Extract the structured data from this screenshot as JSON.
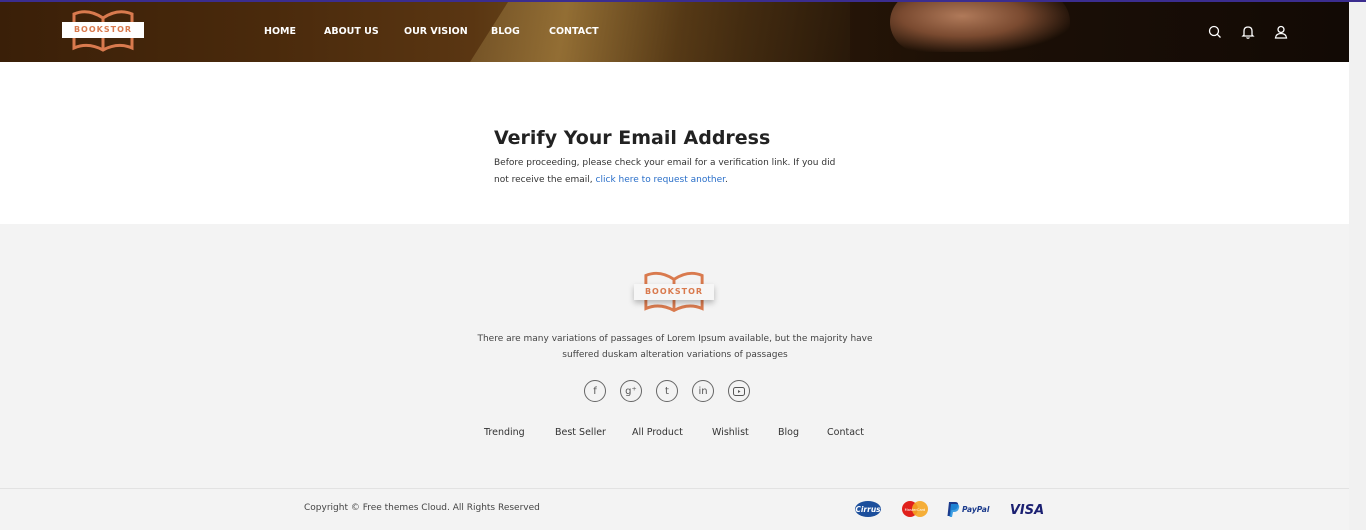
{
  "header": {
    "logo_text": "BOOKSTOR",
    "nav": [
      "HOME",
      "ABOUT US",
      "OUR VISION",
      "BLOG",
      "CONTACT"
    ],
    "icons": [
      "search-icon",
      "bell-icon",
      "user-icon"
    ]
  },
  "verify": {
    "title": "Verify Your Email Address",
    "line1": "Before proceeding, please check your email for a verification link. If you did",
    "line2_prefix": "not receive the email,",
    "link": "click here to request another",
    "line2_suffix": "."
  },
  "footer": {
    "logo_text": "BOOKSTOR",
    "description_line1": "There are many variations of passages of Lorem Ipsum available, but the majority have",
    "description_line2": "suffered duskam alteration variations of passages",
    "social": [
      "facebook-icon",
      "google-plus-icon",
      "tumblr-icon",
      "linkedin-icon",
      "youtube-icon"
    ],
    "links": [
      "Trending",
      "Best Seller",
      "All Product",
      "Wishlist",
      "Blog",
      "Contact"
    ],
    "copyright": "Copyright © Free themes Cloud. All Rights Reserved",
    "payments": [
      "Cirrus",
      "MasterCard",
      "PayPal",
      "VISA"
    ]
  },
  "colors": {
    "accent": "#d97a4e",
    "link": "#2a6fc9",
    "footer_bg": "#f3f3f3"
  }
}
